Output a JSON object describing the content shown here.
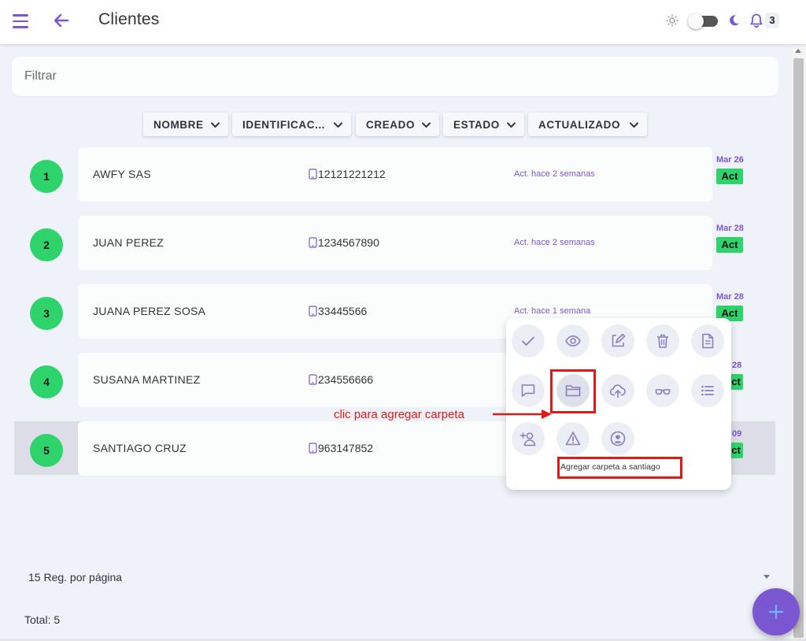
{
  "header": {
    "title": "Clientes",
    "notifications_count": "3"
  },
  "filter": {
    "placeholder": "Filtrar"
  },
  "sort_buttons": [
    {
      "label": "NOMBRE"
    },
    {
      "label": "IDENTIFICAC..."
    },
    {
      "label": "CREADO"
    },
    {
      "label": "ESTADO"
    },
    {
      "label": "ACTUALIZADO"
    }
  ],
  "rows": [
    {
      "num": "1",
      "name": "AWFY SAS",
      "id": "12121221212",
      "updated": "Act. hace 2 semanas",
      "date": "Mar 26",
      "status": "Act"
    },
    {
      "num": "2",
      "name": "JUAN PEREZ",
      "id": "1234567890",
      "updated": "Act. hace 2 semanas",
      "date": "Mar 28",
      "status": "Act"
    },
    {
      "num": "3",
      "name": "JUANA PEREZ SOSA",
      "id": "33445566",
      "updated": "Act. hace 1 semana",
      "date": "Mar 28",
      "status": "Act"
    },
    {
      "num": "4",
      "name": "SUSANA MARTINEZ",
      "id": "234556666",
      "updated": "",
      "date": "28",
      "status": "ct"
    },
    {
      "num": "5",
      "name": "SANTIAGO CRUZ",
      "id": "963147852",
      "updated": "",
      "date": "09",
      "status": "ct"
    }
  ],
  "popup": {
    "tooltip": "Agregar carpeta a santiago",
    "icons": [
      "check-icon",
      "eye-icon",
      "edit-icon",
      "trash-icon",
      "document-icon",
      "comment-icon",
      "folder-icon",
      "cloud-upload-icon",
      "glasses-icon",
      "list-icon",
      "add-user-icon",
      "warning-icon",
      "user-circle-icon"
    ]
  },
  "annotation": {
    "text": "clic para agregar carpeta"
  },
  "footer": {
    "per_page": "15 Reg. por página",
    "total": "Total: 5"
  },
  "colors": {
    "accent": "#7a57d1",
    "status_green": "#2fd36b",
    "annotation_red": "#e01818"
  }
}
